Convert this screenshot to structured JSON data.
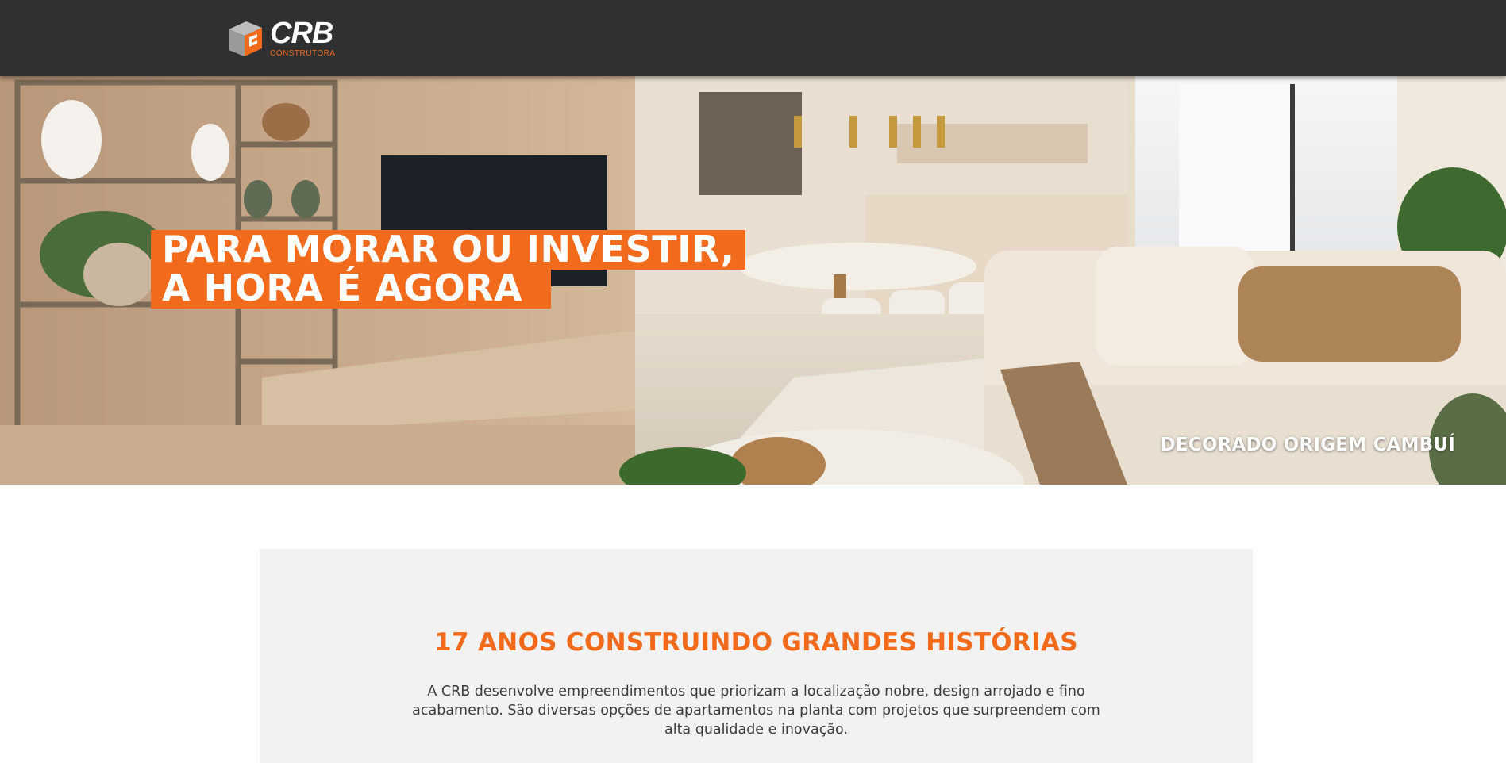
{
  "header": {
    "logo_text": "CRB",
    "logo_subtext": "CONSTRUTORA"
  },
  "hero": {
    "headline_line1": "PARA MORAR OU INVESTIR,",
    "headline_line2": "A HORA É AGORA",
    "caption": "DECORADO ORIGEM CAMBUÍ"
  },
  "about": {
    "title": "17 ANOS CONSTRUINDO GRANDES HISTÓRIAS",
    "text": "A CRB desenvolve empreendimentos que priorizam a localização nobre, design arrojado e fino acabamento. São diversas opções de apartamentos na planta com projetos que surpreendem com alta qualidade e inovação."
  },
  "colors": {
    "header_bg": "#2f3032",
    "accent": "#f26a1b",
    "panel_bg": "#f2f2f2",
    "body_text": "#3c3c3c"
  }
}
